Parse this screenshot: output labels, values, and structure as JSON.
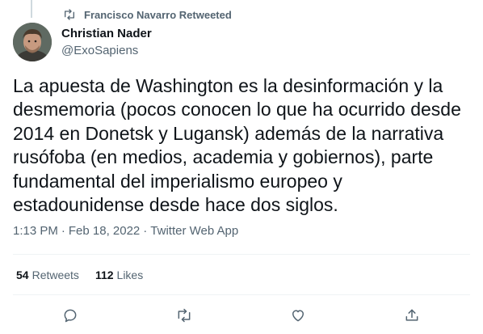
{
  "retweet_context": {
    "label": "Francisco Navarro Retweeted"
  },
  "author": {
    "name": "Christian Nader",
    "handle": "@ExoSapiens"
  },
  "tweet": {
    "text": "La apuesta de Washington es la desinformación y la desmemoria (pocos conocen lo que ha ocurrido desde 2014 en Donetsk y Lugansk) además de la narrativa rusófoba (en medios, academia y gobiernos), parte fundamental del imperialismo europeo y estadounidense desde hace dos siglos.",
    "time": "1:13 PM",
    "date": "Feb 18, 2022",
    "separator": "·",
    "source": "Twitter Web App"
  },
  "stats": {
    "retweets_count": "54",
    "retweets_label": "Retweets",
    "likes_count": "112",
    "likes_label": "Likes"
  },
  "actions": [
    {
      "name": "reply",
      "icon": "reply-icon"
    },
    {
      "name": "retweet",
      "icon": "retweet-icon"
    },
    {
      "name": "like",
      "icon": "heart-icon"
    },
    {
      "name": "share",
      "icon": "share-icon"
    }
  ],
  "colors": {
    "primary_text": "#0f1419",
    "secondary_text": "#536471",
    "divider": "#eff3f4"
  }
}
